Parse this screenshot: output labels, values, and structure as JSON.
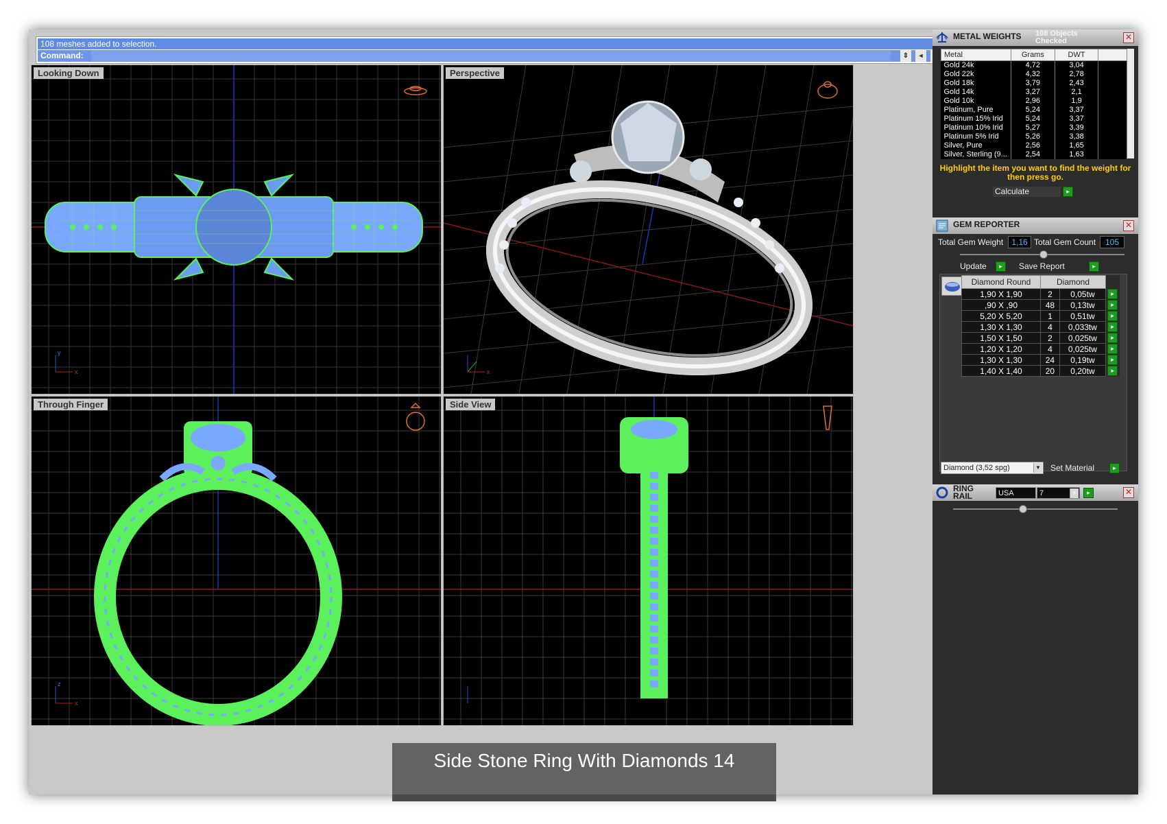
{
  "command": {
    "history": "108 meshes added to selection.",
    "prompt": "Command:"
  },
  "viewports": {
    "top_left": "Looking Down",
    "top_right": "Perspective",
    "bottom_left": "Through Finger",
    "bottom_right": "Side View"
  },
  "caption": "Side Stone Ring With Diamonds 14",
  "metal_weights": {
    "title": "METAL WEIGHTS",
    "objects": "108 Objects Checked",
    "columns": [
      "Metal",
      "Grams",
      "DWT"
    ],
    "rows": [
      [
        "Gold 24k",
        "4,72",
        "3,04"
      ],
      [
        "Gold 22k",
        "4,32",
        "2,78"
      ],
      [
        "Gold 18k",
        "3,79",
        "2,43"
      ],
      [
        "Gold 14k",
        "3,27",
        "2,1"
      ],
      [
        "Gold 10k",
        "2,96",
        "1,9"
      ],
      [
        "Platinum, Pure",
        "5,24",
        "3,37"
      ],
      [
        "Platinum 15% Irid",
        "5,24",
        "3,37"
      ],
      [
        "Platinum 10% Irid",
        "5,27",
        "3,39"
      ],
      [
        "Platinum 5% Irid",
        "5,26",
        "3,38"
      ],
      [
        "Silver, Pure",
        "2,56",
        "1,65"
      ],
      [
        "Silver, Sterling (9...",
        "2,54",
        "1,63"
      ]
    ],
    "hint": "Highlight the item you want to find the weight for then press go.",
    "calculate": "Calculate"
  },
  "gem_reporter": {
    "title": "GEM REPORTER",
    "total_weight_label": "Total Gem Weight",
    "total_weight": "1,16",
    "total_count_label": "Total Gem Count",
    "total_count": "105",
    "update": "Update",
    "save_report": "Save Report",
    "columns": [
      "Diamond Round",
      "Diamond"
    ],
    "rows": [
      [
        "1,90 X 1,90",
        "2",
        "0,05tw"
      ],
      [
        ",90 X ,90",
        "48",
        "0,13tw"
      ],
      [
        "5,20 X 5,20",
        "1",
        "0,51tw"
      ],
      [
        "1,30 X 1,30",
        "4",
        "0,033tw"
      ],
      [
        "1,50 X 1,50",
        "2",
        "0,025tw"
      ],
      [
        "1,20 X 1,20",
        "4",
        "0,025tw"
      ],
      [
        "1,30 X 1,30",
        "24",
        "0,19tw"
      ],
      [
        "1,40 X 1,40",
        "20",
        "0,20tw"
      ]
    ],
    "material": "Diamond     (3,52 spg)",
    "set_material": "Set Material"
  },
  "ring_rail": {
    "title": "RING RAIL",
    "country": "USA",
    "size": "7"
  },
  "colors": {
    "wire_green": "#5cf05c",
    "wire_blue": "#7aa7ff",
    "grid": "#3a3a3a",
    "axis_red": "#b02020",
    "axis_blue": "#2040c0",
    "hint_yellow": "#ffd000"
  }
}
